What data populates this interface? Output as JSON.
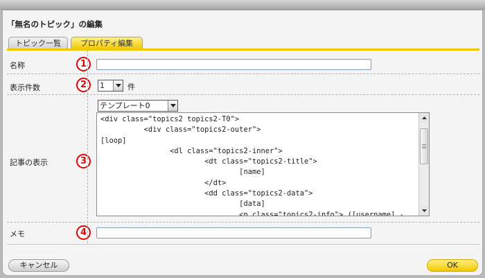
{
  "dialog": {
    "title": "「無名のトピック」の編集"
  },
  "tabs": [
    {
      "label": "トピック一覧",
      "active": false
    },
    {
      "label": "プロパティ編集",
      "active": true
    }
  ],
  "form": {
    "name": {
      "label": "名称",
      "marker": "1",
      "value": ""
    },
    "count": {
      "label": "表示件数",
      "marker": "2",
      "selected": "1",
      "unit": "件"
    },
    "article": {
      "label": "記事の表示",
      "marker": "3",
      "template_selected": "テンプレート0",
      "code": "<div class=\"topics2 topics2-T0\">\n          <div class=\"topics2-outer\">\n[loop]\n                <dl class=\"topics2-inner\">\n                        <dt class=\"topics2-title\">\n                                [name]\n                        </dt>\n                        <dd class=\"topics2-data\">\n                                [data]\n                                <p class=\"topics2-info\"> ([username] -\n[created_year]年[created_month]月[created_day]日 [created_hour]:"
    },
    "memo": {
      "label": "メモ",
      "marker": "4",
      "value": ""
    }
  },
  "buttons": {
    "cancel": "キャンセル",
    "ok": "OK"
  },
  "colors": {
    "accent": "#f2c700",
    "marker": "#e30000",
    "input_border": "#7f9db9"
  },
  "icons": {
    "dropdown": "triangle-down",
    "scroll_up": "triangle-up",
    "scroll_down": "triangle-down"
  }
}
